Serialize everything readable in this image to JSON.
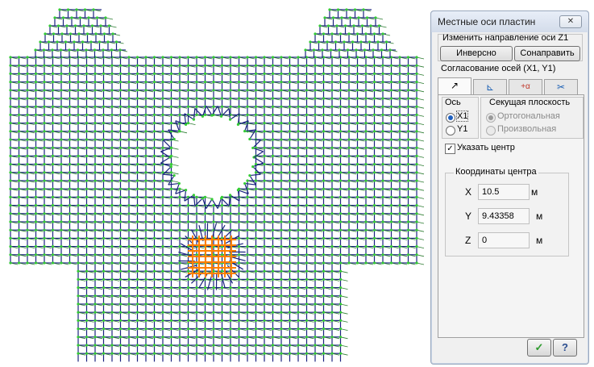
{
  "dialog": {
    "title": "Местные оси пластин",
    "close_icon": "close-icon",
    "z_section_label": "Изменить направление оси Z1",
    "invert_button": "Инверсно",
    "align_button": "Сонаправить",
    "match_axes_label": "Согласование осей (X1, Y1)",
    "tabs": [
      {
        "icon": "pointer-icon",
        "glyph": "↗"
      },
      {
        "icon": "axes-icon",
        "glyph": "⊾"
      },
      {
        "icon": "angle-icon",
        "glyph": "+α"
      },
      {
        "icon": "scissors-icon",
        "glyph": "✂"
      }
    ],
    "axis_group_label": "Ось",
    "axis_options": [
      "X1",
      "Y1"
    ],
    "axis_selected": "X1",
    "plane_group_label": "Секущая плоскость",
    "plane_options": [
      "Ортогональная",
      "Произвольная"
    ],
    "plane_selected": "Ортогональная",
    "specify_center_label": "Указать центр",
    "specify_center_checked": true,
    "coords_group_label": "Координаты центра",
    "coords": [
      {
        "axis": "X",
        "value": "10.5",
        "unit": "м"
      },
      {
        "axis": "Y",
        "value": "9.43358",
        "unit": "м"
      },
      {
        "axis": "Z",
        "value": "0",
        "unit": "м"
      }
    ],
    "ok_icon": "checkmark-icon",
    "help_label": "?"
  },
  "colors": {
    "grid_lines": "#1a237e",
    "axis_ticks": "#2e7d32",
    "nodes": "#33cc33",
    "highlight": "#ff7f00"
  }
}
